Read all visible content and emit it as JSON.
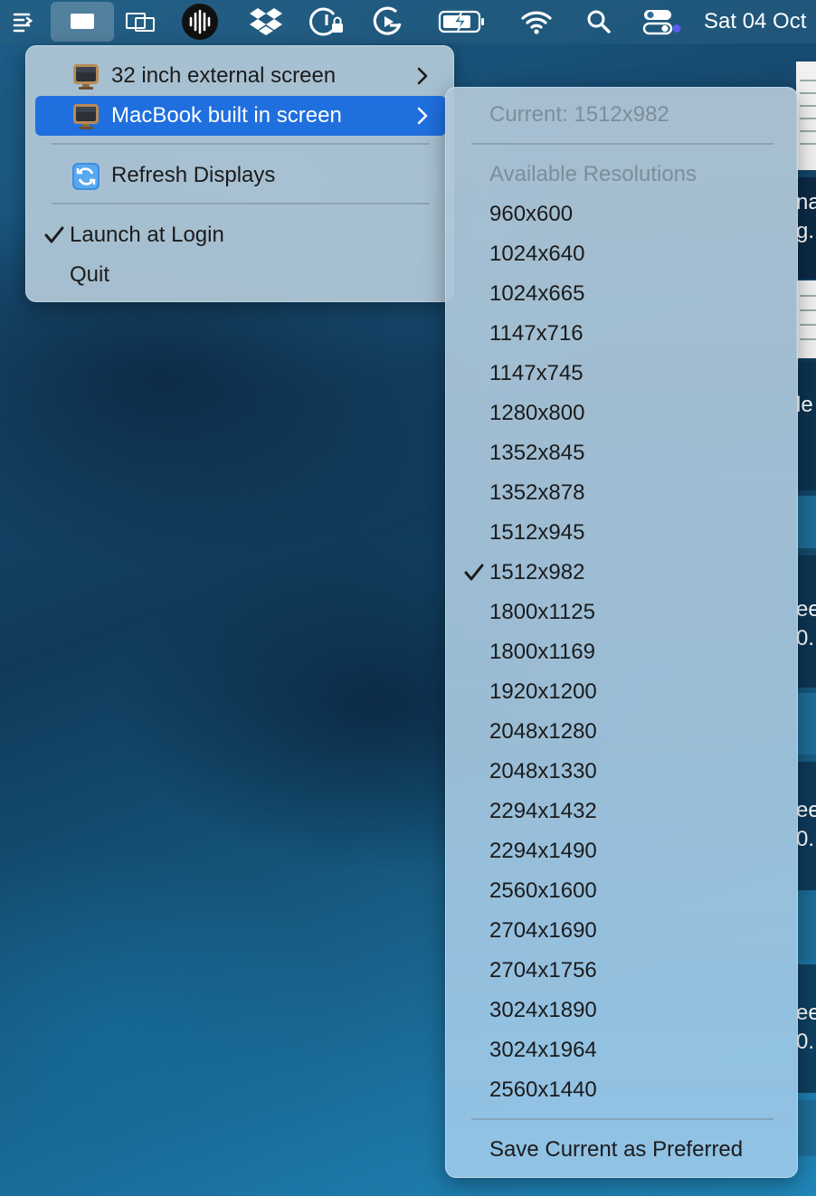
{
  "menubar": {
    "icons": [
      "list-menu-icon",
      "display-menu-icon",
      "screens-icon",
      "audio-waveform-icon",
      "dropbox-icon",
      "vpn-lock-icon",
      "elgato-icon",
      "battery-charging-icon",
      "wifi-icon",
      "search-icon",
      "control-center-icon"
    ],
    "clock": "Sat 04 Oct"
  },
  "menu": {
    "items": [
      {
        "label": "32 inch external screen",
        "icon": "monitor-icon",
        "has_submenu": true
      },
      {
        "label": "MacBook built in screen",
        "icon": "monitor-icon",
        "has_submenu": true,
        "highlighted": true
      },
      {
        "label": "Refresh Displays",
        "icon": "refresh-icon"
      },
      {
        "label": "Launch at Login",
        "checked": true
      },
      {
        "label": "Quit"
      }
    ]
  },
  "submenu": {
    "current": "Current: 1512x982",
    "section_header": "Available Resolutions",
    "resolutions": [
      "960x600",
      "1024x640",
      "1024x665",
      "1147x716",
      "1147x745",
      "1280x800",
      "1352x845",
      "1352x878",
      "1512x945",
      "1512x982",
      "1800x1125",
      "1800x1169",
      "1920x1200",
      "2048x1280",
      "2048x1330",
      "2294x1432",
      "2294x1490",
      "2560x1600",
      "2704x1690",
      "2704x1756",
      "3024x1890",
      "3024x1964",
      "2560x1440"
    ],
    "selected": "1512x982",
    "save_label": "Save Current as Preferred"
  },
  "background_fragments": [
    "na",
    "g..",
    "le",
    "ee",
    "0..",
    "ee",
    "0.",
    "ee",
    "0."
  ],
  "colors": {
    "highlight": "#1f6fde",
    "menu_bg": "#b2c8d7",
    "disabled_text": "#7d8d99"
  }
}
